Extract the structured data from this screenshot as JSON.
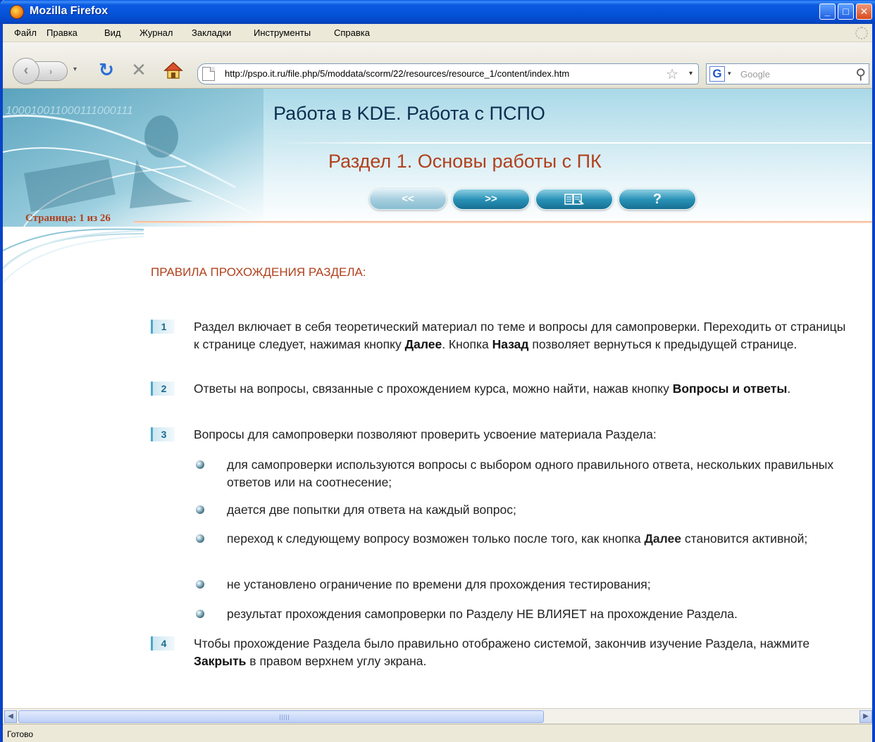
{
  "window": {
    "title": "Mozilla Firefox"
  },
  "menu": [
    {
      "label": "Файл"
    },
    {
      "label": "Правка"
    },
    {
      "label": "Вид"
    },
    {
      "label": "Журнал"
    },
    {
      "label": "Закладки"
    },
    {
      "label": "Инструменты"
    },
    {
      "label": "Справка"
    }
  ],
  "navbar": {
    "url": "http://pspo.it.ru/file.php/5/moddata/scorm/22/resources/resource_1/content/index.htm",
    "search_placeholder": "Google"
  },
  "page": {
    "course_title": "Работа в KDE. Работа с ПСПО",
    "section_title": "Раздел 1. Основы работы с ПК",
    "nav": {
      "prev_label": "<<",
      "next_label": ">>",
      "help_label": "?"
    },
    "page_counter": "Страница: 1 из 26",
    "rules_heading": "ПРАВИЛА ПРОХОЖДЕНИЯ РАЗДЕЛА:",
    "rules": [
      {
        "num": "1"
      },
      {
        "num": "2"
      },
      {
        "num": "3",
        "text": "Вопросы для самопроверки позволяют проверить усвоение материала Раздела:"
      },
      {
        "num": "4"
      }
    ],
    "rule1": {
      "part1": "Раздел включает в себя теоретический материал по теме и вопросы для самопроверки. Переходить от страницы к странице следует, нажимая кнопку ",
      "bold1": "Далее",
      "part2": ". Кнопка ",
      "bold2": "Назад",
      "part3": " позволяет вернуться к предыдущей странице."
    },
    "rule2": {
      "part1": "Ответы на вопросы, связанные с прохождением курса, можно найти, нажав кнопку ",
      "bold1": "Вопросы и ответы",
      "part2": "."
    },
    "rule4": {
      "part1": "Чтобы прохождение Раздела было правильно отображено системой, закончив изучение Раздела, нажмите ",
      "bold1": "Закрыть",
      "part2": " в правом верхнем углу экрана."
    },
    "bullets": [
      {
        "text": "для самопроверки используются вопросы с выбором одного правильного ответа, нескольких правильных ответов или на соотнесение;"
      },
      {
        "text": "дается две попытки для ответа на каждый вопрос;"
      },
      {
        "text": "не установлено ограничение по времени для прохождения тестирования;"
      },
      {
        "text": "результат прохождения самопроверки по Разделу НЕ ВЛИЯЕТ на прохождение Раздела."
      }
    ],
    "bullet3": {
      "part1": "переход к следующему вопросу возможен только после того, как кнопка ",
      "bold1": "Далее",
      "part2": " становится активной;"
    },
    "banner_digits": "100010011000111000111"
  },
  "status": {
    "text": "Готово"
  },
  "colors": {
    "accent_orange": "#b1401c",
    "accent_teal": "#2a93b8",
    "xp_blue": "#0452d8"
  },
  "icons": [
    "firefox-icon",
    "back-icon",
    "forward-icon",
    "reload-icon",
    "stop-icon",
    "home-icon",
    "page-icon",
    "star-icon",
    "google-icon",
    "search-icon"
  ]
}
